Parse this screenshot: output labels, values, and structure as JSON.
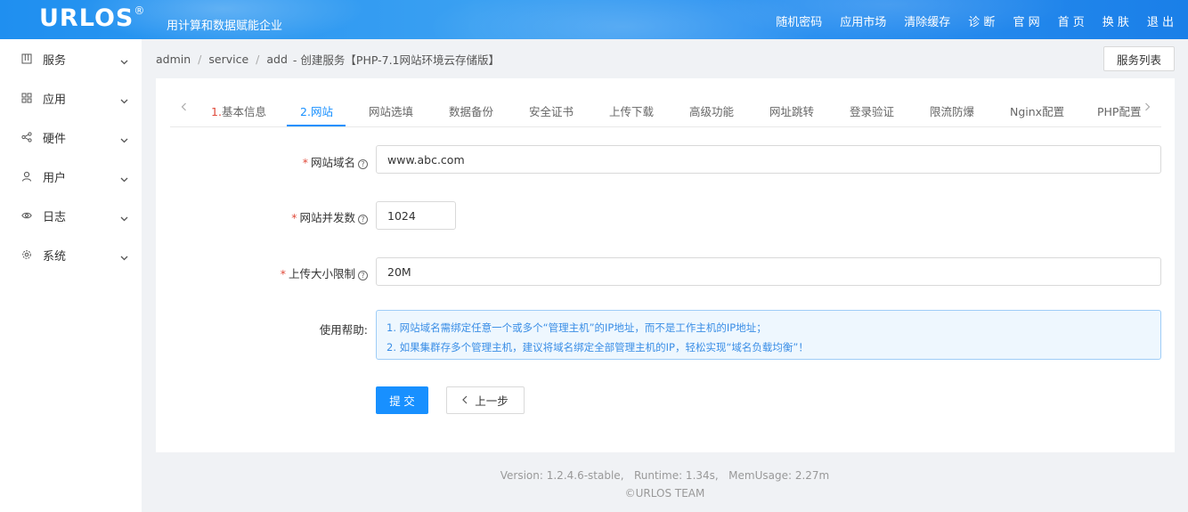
{
  "header": {
    "logo": "URLOS",
    "logo_mark": "®",
    "slogan": "用计算和数据赋能企业",
    "nav": [
      "随机密码",
      "应用市场",
      "清除缓存",
      "诊 断",
      "官 网",
      "首 页",
      "换 肤",
      "退 出"
    ]
  },
  "sidebar": {
    "items": [
      {
        "label": "服务",
        "icon": "grid-bars-icon"
      },
      {
        "label": "应用",
        "icon": "apps-icon"
      },
      {
        "label": "硬件",
        "icon": "share-nodes-icon"
      },
      {
        "label": "用户",
        "icon": "user-icon"
      },
      {
        "label": "日志",
        "icon": "eye-icon"
      },
      {
        "label": "系统",
        "icon": "gear-icon"
      }
    ]
  },
  "breadcrumb": {
    "items": [
      "admin",
      "service",
      "add"
    ],
    "suffix": "- 创建服务【PHP-7.1网站环境云存储版】"
  },
  "service_list_button": "服务列表",
  "tabs": [
    {
      "num": "1.",
      "label": "基本信息",
      "active": false
    },
    {
      "num": "2.",
      "label": "网站",
      "active": true
    },
    {
      "num": "",
      "label": "网站选填",
      "active": false
    },
    {
      "num": "",
      "label": "数据备份",
      "active": false
    },
    {
      "num": "",
      "label": "安全证书",
      "active": false
    },
    {
      "num": "",
      "label": "上传下载",
      "active": false
    },
    {
      "num": "",
      "label": "高级功能",
      "active": false
    },
    {
      "num": "",
      "label": "网址跳转",
      "active": false
    },
    {
      "num": "",
      "label": "登录验证",
      "active": false
    },
    {
      "num": "",
      "label": "限流防爆",
      "active": false
    },
    {
      "num": "",
      "label": "Nginx配置",
      "active": false
    },
    {
      "num": "",
      "label": "PHP配置",
      "active": false
    }
  ],
  "form": {
    "domain": {
      "label": "网站域名",
      "value": "www.abc.com"
    },
    "concurrency": {
      "label": "网站并发数",
      "value": "1024"
    },
    "upload_limit": {
      "label": "上传大小限制",
      "value": "20M"
    },
    "help": {
      "label": "使用帮助:",
      "lines": [
        "1. 网站域名需绑定任意一个或多个“管理主机”的IP地址，而不是工作主机的IP地址；",
        "2. 如果集群存多个管理主机，建议将域名绑定全部管理主机的IP，轻松实现“域名负载均衡”！"
      ]
    },
    "submit_label": "提 交",
    "prev_label": "上一步"
  },
  "footer": {
    "line1": "Version: 1.2.4.6-stable,   Runtime: 1.34s,   MemUsage: 2.27m",
    "line2": "©URLOS TEAM"
  },
  "colors": {
    "primary": "#1890ff",
    "required": "#e04a3a",
    "header_bg": "#2a8ff0"
  }
}
